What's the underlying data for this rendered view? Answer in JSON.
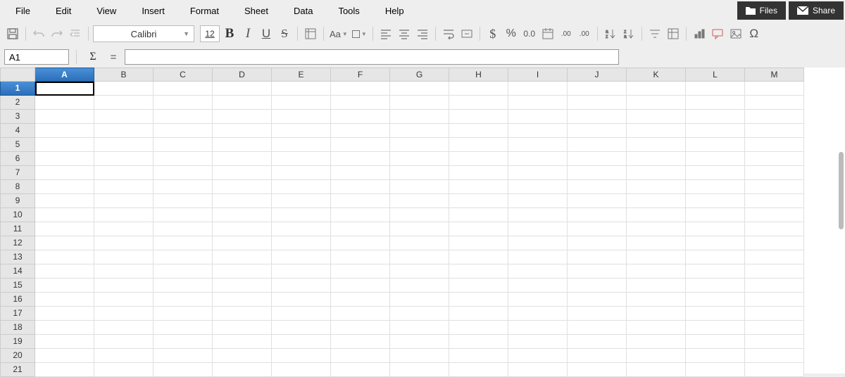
{
  "menu": {
    "items": [
      "File",
      "Edit",
      "View",
      "Insert",
      "Format",
      "Sheet",
      "Data",
      "Tools",
      "Help"
    ]
  },
  "top_right": {
    "files": "Files",
    "share": "Share"
  },
  "toolbar": {
    "font_name": "Calibri",
    "font_size": "12",
    "case_label": "Aa",
    "currency": "$",
    "percent": "%",
    "number_fmt": "0.0",
    "add_decimal": ".00→",
    "remove_decimal": "←.00"
  },
  "formula_bar": {
    "cell_ref": "A1",
    "sigma": "Σ",
    "equals": "=",
    "formula": ""
  },
  "grid": {
    "columns": [
      "A",
      "B",
      "C",
      "D",
      "E",
      "F",
      "G",
      "H",
      "I",
      "J",
      "K",
      "L",
      "M"
    ],
    "rows": [
      "1",
      "2",
      "3",
      "4",
      "5",
      "6",
      "7",
      "8",
      "9",
      "10",
      "11",
      "12",
      "13",
      "14",
      "15",
      "16",
      "17",
      "18",
      "19",
      "20",
      "21"
    ],
    "selected_col": "A",
    "selected_row": "1"
  }
}
